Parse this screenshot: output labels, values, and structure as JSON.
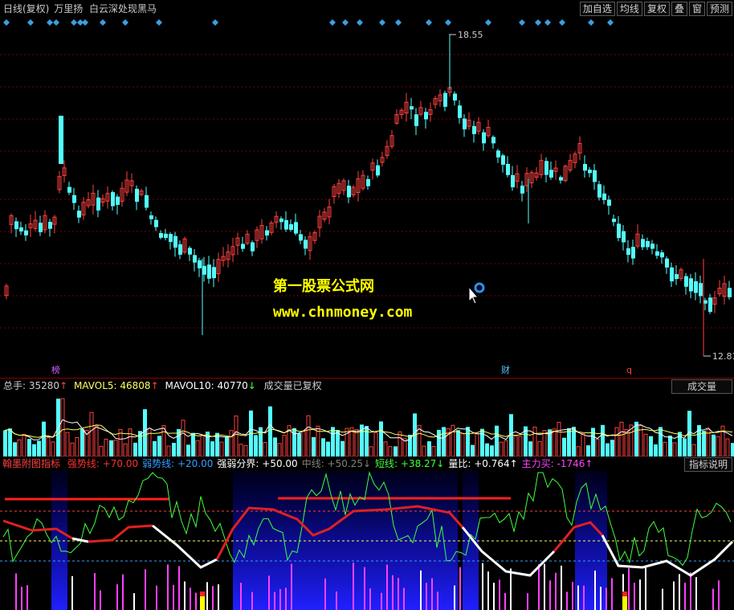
{
  "title": {
    "period": "日线(复权)",
    "stock": "万里扬",
    "indicator_name": "白云深处现黑马"
  },
  "toolbar": {
    "buttons": [
      "加自选",
      "均线",
      "复权",
      "叠",
      "窗",
      "预测"
    ]
  },
  "price_panel": {
    "high_label": "18.55",
    "low_label": "12.81",
    "markers": {
      "bang": "榜",
      "cai": "财",
      "q": "q"
    }
  },
  "watermark": {
    "line1": "第一股票公式网",
    "line2": "www.chnmoney.com"
  },
  "volume_header": {
    "total_label": "总手:",
    "total_value": "35280",
    "total_arrow": "↑",
    "mavol5_label": "MAVOL5:",
    "mavol5_value": "46808",
    "mavol5_arrow": "↑",
    "mavol10_label": "MAVOL10:",
    "mavol10_value": "40770",
    "mavol10_arrow": "↓",
    "note": "成交量已复权",
    "tab": "成交量"
  },
  "indicator_header": {
    "name": "翰墨附图指标",
    "items": [
      {
        "label": "强势线:",
        "value": "+70.00",
        "color": "#ff3030"
      },
      {
        "label": "弱势线:",
        "value": "+20.00",
        "color": "#33a0ff"
      },
      {
        "label": "强弱分界:",
        "value": "+50.00",
        "color": "#ffffff"
      },
      {
        "label": "中线:",
        "value": "+50.25",
        "arrow": "↓",
        "color": "#808080"
      },
      {
        "label": "短线:",
        "value": "+38.27",
        "arrow": "↓",
        "color": "#40ff40"
      },
      {
        "label": "量比:",
        "value": "+0.764",
        "arrow": "↑",
        "color": "#ffffff"
      },
      {
        "label": "主力买:",
        "value": "-1746",
        "arrow": "↑",
        "color": "#ff40ff"
      }
    ],
    "help_button": "指标说明"
  },
  "colors": {
    "up": "#ff4040",
    "down": "#54ffff",
    "accent_yellow": "#ffff00",
    "diamond": "#3aa0e0"
  }
}
